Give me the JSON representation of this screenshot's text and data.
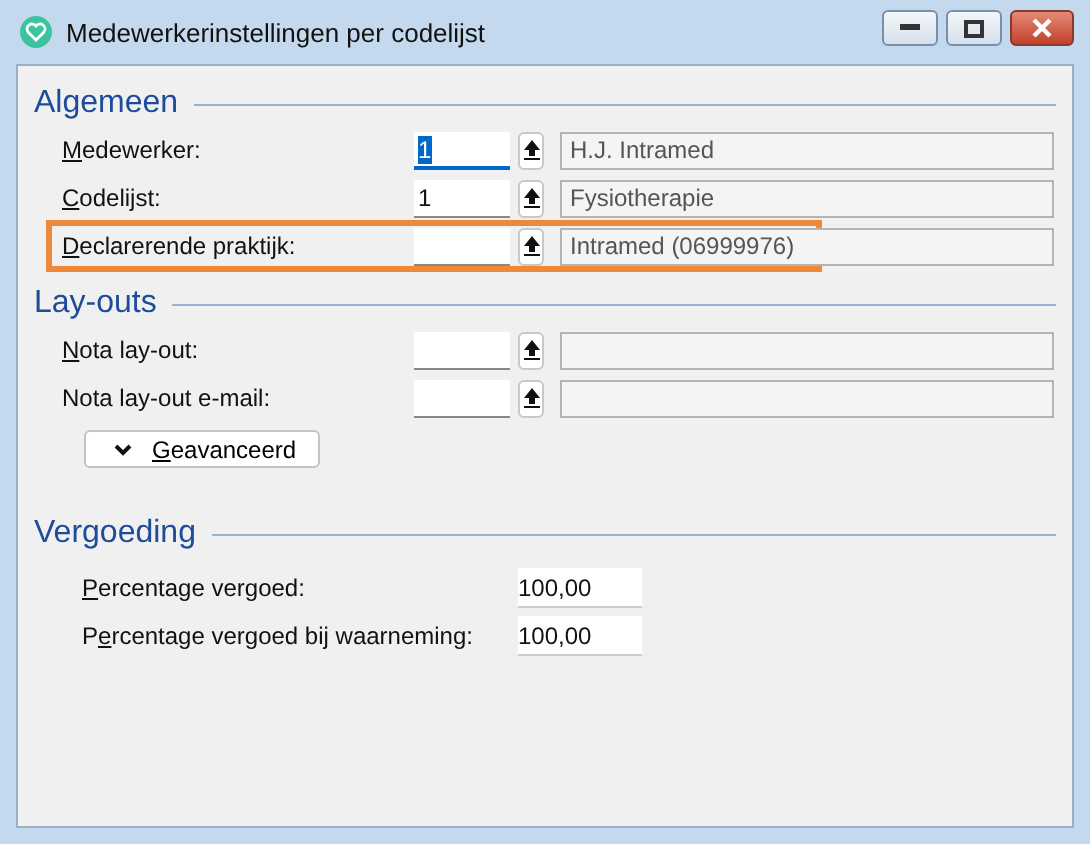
{
  "window": {
    "title": "Medewerkerinstellingen per codelijst"
  },
  "sections": [
    {
      "heading": "Algemeen",
      "rows": [
        {
          "access_key": "M",
          "label_end": "edewerker:",
          "value": "1",
          "value_selected": true,
          "lookup": "H.J. Intramed",
          "highlighted": false
        },
        {
          "access_key": "C",
          "label_end": "odelijst:",
          "value": "1",
          "value_selected": false,
          "lookup": "Fysiotherapie",
          "highlighted": false
        },
        {
          "access_key": "D",
          "label_end": "eclarerende praktijk:",
          "value": "",
          "value_selected": false,
          "lookup": "Intramed (06999976)",
          "highlighted": true
        }
      ]
    },
    {
      "heading": "Lay-outs",
      "rows": [
        {
          "access_key": "N",
          "label_end": "ota lay-out:",
          "value": "",
          "value_selected": false,
          "lookup": "",
          "highlighted": false
        },
        {
          "label_end": "Nota lay-out e-mail:",
          "value": "",
          "value_selected": false,
          "lookup": "",
          "highlighted": false
        }
      ],
      "button": {
        "access_key": "G",
        "label_end": "eavanceerd"
      }
    },
    {
      "heading": "Vergoeding",
      "percentages": [
        {
          "access_key": "P",
          "label_end": "ercentage vergoed:",
          "value": "100,00"
        },
        {
          "label_start": "P",
          "access_key": "e",
          "label_end": "rcentage vergoed bij waarneming:",
          "value": "100,00"
        }
      ]
    }
  ]
}
